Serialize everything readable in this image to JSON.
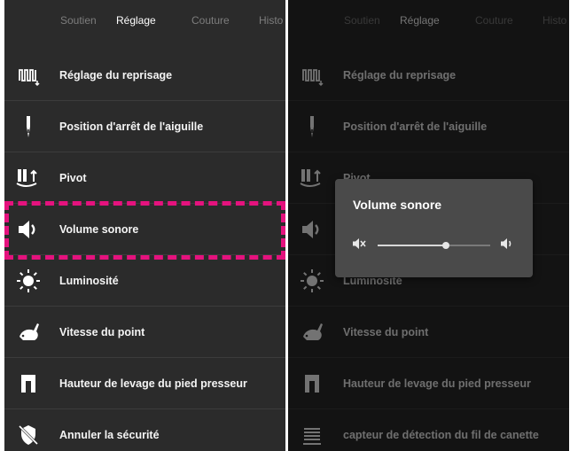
{
  "tabs": [
    "Soutien",
    "Réglage",
    "Couture",
    "Histo"
  ],
  "active_tab": 1,
  "items": [
    {
      "label": "Réglage du reprisage",
      "icon": "darning-icon"
    },
    {
      "label": "Position d'arrêt de l'aiguille",
      "icon": "needle-icon"
    },
    {
      "label": "Pivot",
      "icon": "pivot-icon"
    },
    {
      "label": "Volume sonore",
      "icon": "speaker-icon"
    },
    {
      "label": "Luminosité",
      "icon": "brightness-icon"
    },
    {
      "label": "Vitesse du point",
      "icon": "rabbit-speed-icon"
    },
    {
      "label": "Hauteur de levage du pied presseur",
      "icon": "presser-foot-icon"
    },
    {
      "label": "Annuler la sécurité",
      "icon": "security-off-icon"
    }
  ],
  "right_last_item": {
    "label": "capteur de détection du fil de canette",
    "icon": "bobbin-sensor-icon"
  },
  "highlight_index": 3,
  "highlight_color": "#e5127e",
  "dialog": {
    "title": "Volume sonore",
    "volume_fraction": 0.61
  }
}
